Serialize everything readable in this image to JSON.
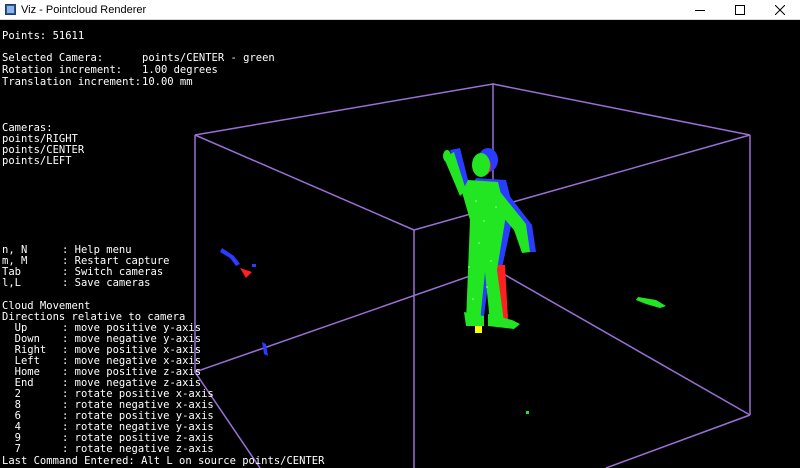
{
  "window": {
    "title": "Viz - Pointcloud Renderer",
    "icons": [
      "app-icon",
      "minimize-icon",
      "maximize-icon",
      "close-icon"
    ]
  },
  "hud": {
    "points_line": "Points: 51611",
    "selected_camera": {
      "label": "Selected Camera:",
      "value": "points/CENTER - green"
    },
    "rotation_increment": {
      "label": "Rotation increment:",
      "value": "1.00 degrees"
    },
    "translation_increment": {
      "label": "Translation increment:",
      "value": "10.00 mm"
    },
    "cameras_header": "Cameras:",
    "cameras": [
      "points/RIGHT",
      "points/CENTER",
      "points/LEFT"
    ],
    "help": [
      {
        "key": "n, N",
        "desc": ": Help menu"
      },
      {
        "key": "m, M",
        "desc": ": Restart capture"
      },
      {
        "key": "Tab",
        "desc": ": Switch cameras"
      },
      {
        "key": "l,L",
        "desc": ": Save cameras"
      }
    ],
    "movement_header": "Cloud Movement",
    "movement_subheader": "Directions relative to camera",
    "movement": [
      {
        "key": "  Up",
        "desc": ": move positive y-axis"
      },
      {
        "key": "  Down",
        "desc": ": move negative y-axis"
      },
      {
        "key": "  Right",
        "desc": ": move positive x-axis"
      },
      {
        "key": "  Left",
        "desc": ": move negative x-axis"
      },
      {
        "key": "  Home",
        "desc": ": move positive z-axis"
      },
      {
        "key": "  End",
        "desc": ": move negative z-axis"
      },
      {
        "key": "  2",
        "desc": ": rotate positive x-axis"
      },
      {
        "key": "  8",
        "desc": ": rotate negative x-axis"
      },
      {
        "key": "  6",
        "desc": ": rotate positive y-axis"
      },
      {
        "key": "  4",
        "desc": ": rotate negative y-axis"
      },
      {
        "key": "  9",
        "desc": ": rotate positive z-axis"
      },
      {
        "key": "  7",
        "desc": ": rotate negative z-axis"
      }
    ],
    "last_command": "Last Command Entered: Alt L on source points/CENTER"
  },
  "colors": {
    "background": "#000000",
    "bounding_box": "#9a6fd6",
    "cloud_center": "#22e622",
    "cloud_right": "#ff2020",
    "cloud_left": "#2a3cff",
    "marker": "#ffff00",
    "text": "#ffffff"
  }
}
